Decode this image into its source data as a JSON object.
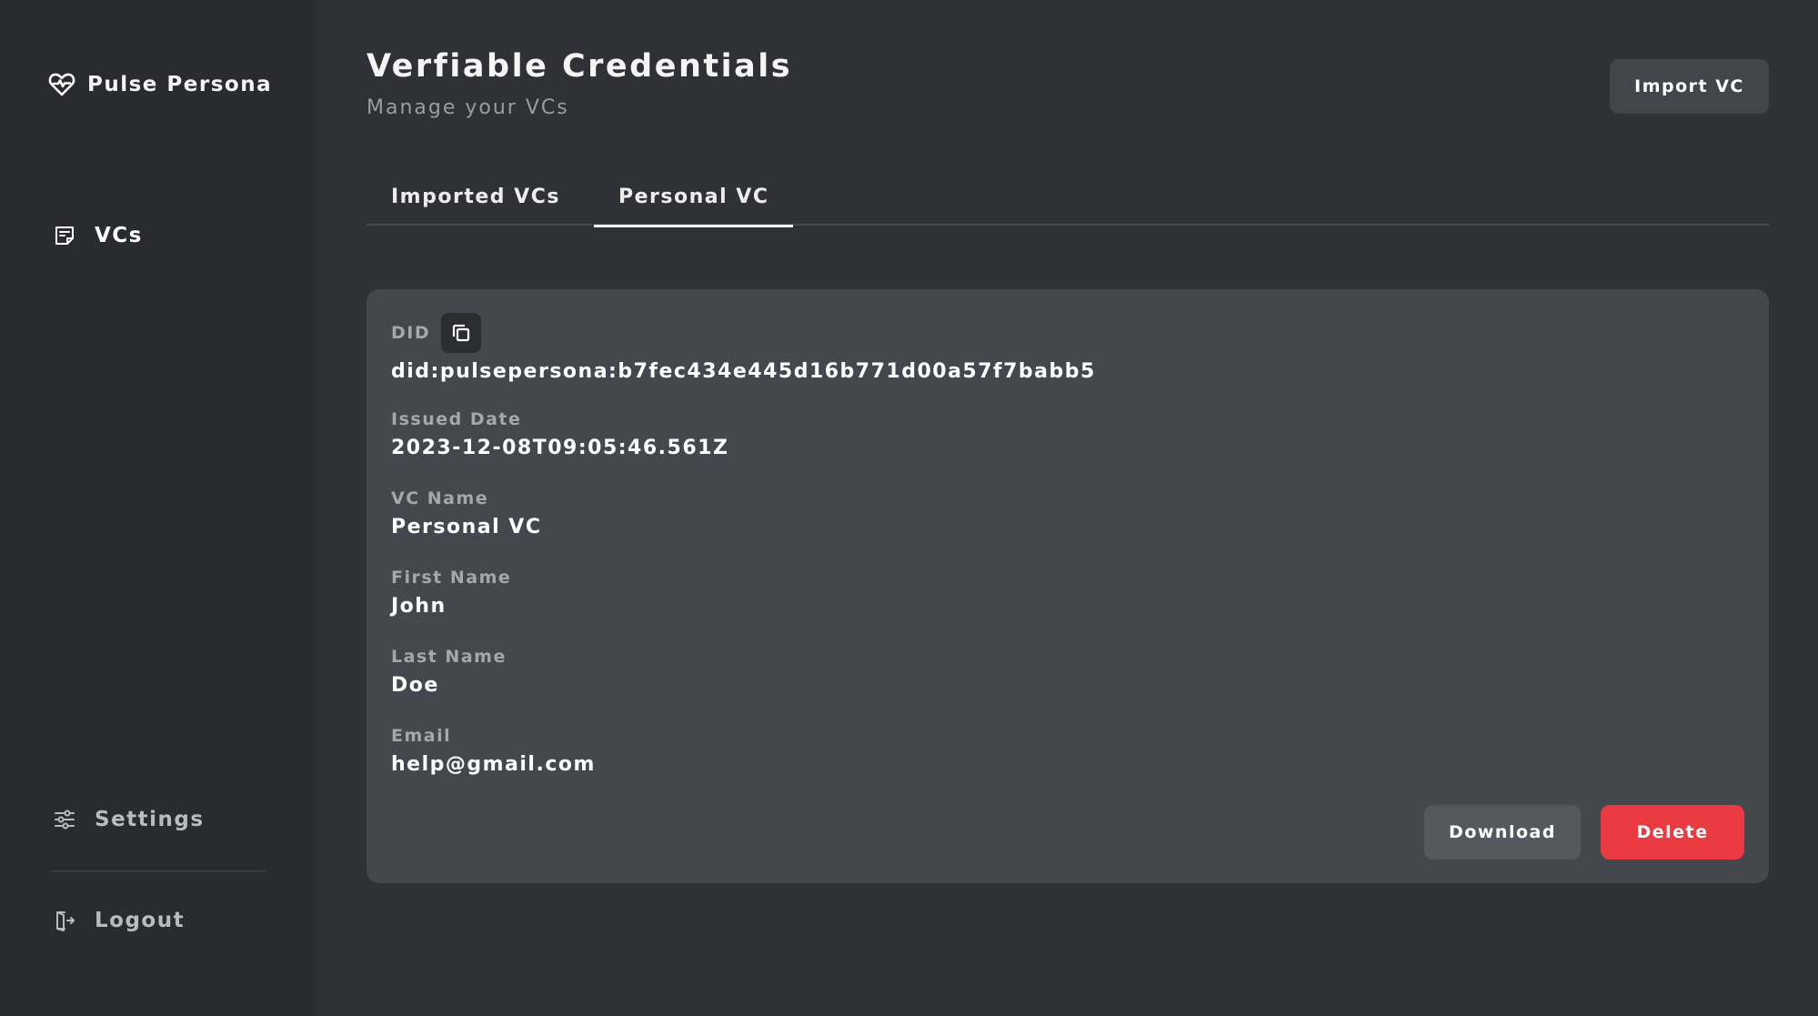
{
  "app": {
    "name": "Pulse Persona"
  },
  "sidebar": {
    "items": [
      {
        "label": "VCs",
        "icon": "note-icon"
      },
      {
        "label": "Settings",
        "icon": "sliders-icon"
      },
      {
        "label": "Logout",
        "icon": "logout-icon"
      }
    ]
  },
  "header": {
    "title": "Verfiable Credentials",
    "subtitle": "Manage your VCs",
    "import_label": "Import VC"
  },
  "tabs": [
    {
      "label": "Imported VCs",
      "active": false
    },
    {
      "label": "Personal VC",
      "active": true
    }
  ],
  "credential": {
    "did_label": "DID",
    "did_value": "did:pulsepersona:b7fec434e445d16b771d00a57f7babb5",
    "fields": [
      {
        "label": "Issued Date",
        "value": "2023-12-08T09:05:46.561Z"
      },
      {
        "label": "VC Name",
        "value": "Personal VC"
      },
      {
        "label": "First Name",
        "value": "John"
      },
      {
        "label": "Last Name",
        "value": "Doe"
      },
      {
        "label": "Email",
        "value": "help@gmail.com"
      }
    ],
    "download_label": "Download",
    "delete_label": "Delete"
  },
  "colors": {
    "background": "#303136",
    "sidebar": "#2a2b2f",
    "card": "#44474e",
    "delete": "#ea3b42"
  }
}
